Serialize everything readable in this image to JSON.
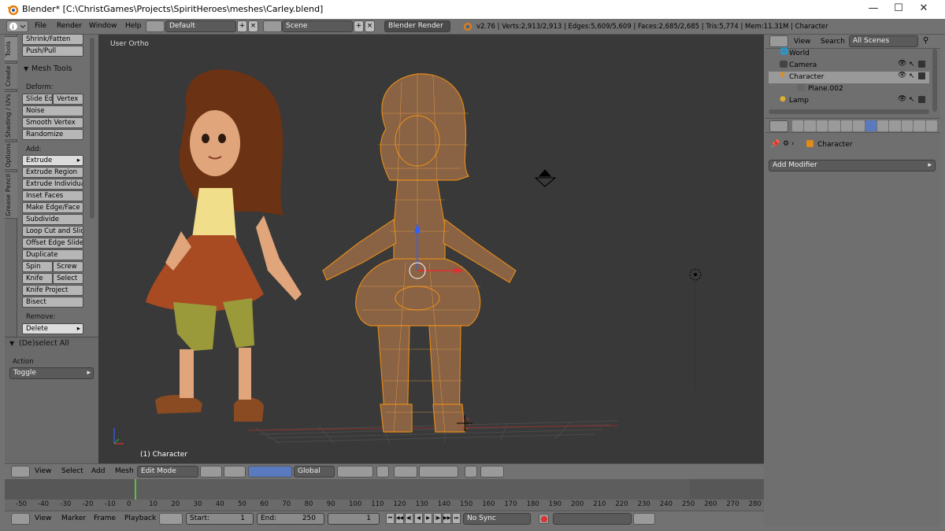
{
  "window": {
    "title": "Blender* [C:\\ChristGames\\Projects\\SpiritHeroes\\meshes\\Carley.blend]",
    "minimize": "—",
    "maximize": "☐",
    "close": "✕"
  },
  "info": {
    "menus": [
      "File",
      "Render",
      "Window",
      "Help"
    ],
    "layout": "Default",
    "scene": "Scene",
    "engine": "Blender Render",
    "stats": "v2.76 | Verts:2,913/2,913 | Edges:5,609/5,609 | Faces:2,685/2,685 | Tris:5,774 | Mem:11.31M | Character"
  },
  "tabs": [
    "Tools",
    "Create",
    "Shading / UVs",
    "Options",
    "Grease Pencil"
  ],
  "toolshelf": {
    "top_buttons": [
      "Shrink/Fatten",
      "Push/Pull"
    ],
    "panel_title": "Mesh Tools",
    "deform_label": "Deform:",
    "deform_pair": [
      "Slide Ed",
      "Vertex"
    ],
    "deform_items": [
      "Noise",
      "Smooth Vertex",
      "Randomize"
    ],
    "add_label": "Add:",
    "add_dropdown": "Extrude",
    "add_items": [
      "Extrude Region",
      "Extrude Individual",
      "Inset Faces",
      "Make Edge/Face",
      "Subdivide",
      "Loop Cut and Slide",
      "Offset Edge Slide",
      "Duplicate"
    ],
    "pair1": [
      "Spin",
      "Screw"
    ],
    "pair2": [
      "Knife",
      "Select"
    ],
    "add_items2": [
      "Knife Project",
      "Bisect"
    ],
    "remove_label": "Remove:",
    "remove_dropdown": "Delete",
    "operator_title": "(De)select All",
    "action_label": "Action",
    "action_value": "Toggle"
  },
  "viewport": {
    "view_name": "User Ortho",
    "object_label": "(1) Character"
  },
  "vp_header": {
    "menus": [
      "View",
      "Select",
      "Add",
      "Mesh"
    ],
    "mode": "Edit Mode",
    "orientation": "Global"
  },
  "timeline": {
    "ticks": [
      "-50",
      "-40",
      "-30",
      "-20",
      "-10",
      "0",
      "10",
      "20",
      "30",
      "40",
      "50",
      "60",
      "70",
      "80",
      "90",
      "100",
      "110",
      "120",
      "130",
      "140",
      "150",
      "160",
      "170",
      "180",
      "190",
      "200",
      "210",
      "220",
      "230",
      "240",
      "250",
      "260",
      "270",
      "280"
    ]
  },
  "tl_footer": {
    "menus": [
      "View",
      "Marker",
      "Frame",
      "Playback"
    ],
    "start_label": "Start:",
    "start": "1",
    "end_label": "End:",
    "end": "250",
    "current": "1",
    "sync": "No Sync",
    "transport": [
      "⏮",
      "◀◀",
      "◀|",
      "◀",
      "▶",
      "|▶",
      "▶▶",
      "⏭"
    ]
  },
  "outliner": {
    "view": "View",
    "search": "Search",
    "scenes": "All Scenes",
    "items": [
      {
        "name": "World"
      },
      {
        "name": "Camera"
      },
      {
        "name": "Character"
      },
      {
        "name": "Plane.002"
      },
      {
        "name": "Lamp"
      }
    ]
  },
  "properties": {
    "object": "Character",
    "add_modifier": "Add Modifier"
  },
  "colors": {
    "accent": "#e08a1a",
    "viewport_bg": "#393939",
    "panel_bg": "#727272",
    "selected": "#999999"
  }
}
